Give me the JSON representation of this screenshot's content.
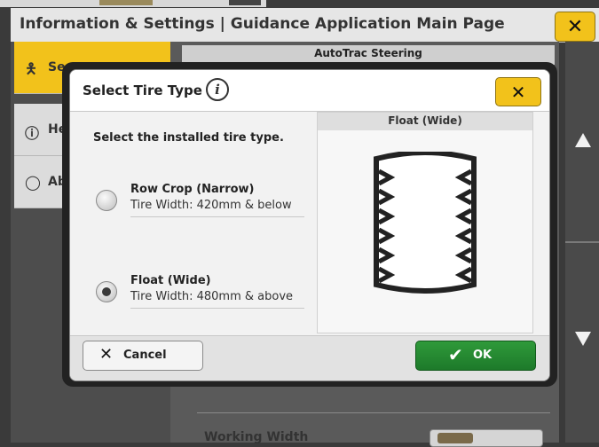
{
  "header": {
    "title": "Information & Settings | Guidance Application Main Page",
    "close_icon": "close-icon"
  },
  "sidebar": {
    "items": [
      {
        "label": "Se",
        "icon": "person-icon"
      },
      {
        "label": "He",
        "icon": "help-icon"
      },
      {
        "label": "Ab",
        "icon": "chat-icon"
      }
    ]
  },
  "main": {
    "section_title": "AutoTrac Steering",
    "bottom_label": "Working Width"
  },
  "dialog": {
    "title": "Select Tire Type",
    "prompt": "Select the installed tire type.",
    "options": [
      {
        "title": "Row Crop (Narrow)",
        "subtitle": "Tire Width: 420mm & below",
        "selected": false
      },
      {
        "title": "Float (Wide)",
        "subtitle": "Tire Width: 480mm & above",
        "selected": true
      }
    ],
    "preview_title": "Float (Wide)",
    "cancel_label": "Cancel",
    "ok_label": "OK"
  },
  "colors": {
    "accent": "#f2c21b",
    "ok": "#248a31",
    "panel": "#4d4d4d"
  }
}
